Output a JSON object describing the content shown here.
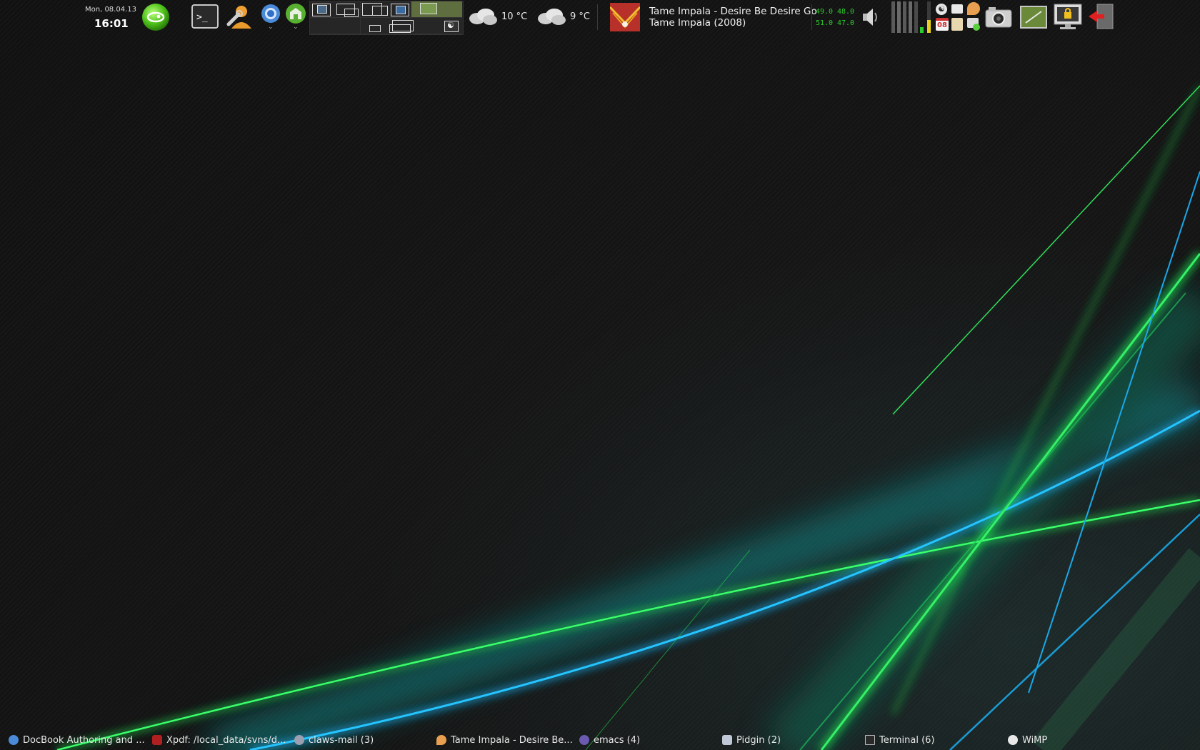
{
  "clock": {
    "date": "Mon, 08.04.13",
    "time": "16:01"
  },
  "weather": [
    {
      "icon": "cloudy-icon",
      "temp": "10 °C"
    },
    {
      "icon": "cloudy-icon",
      "temp": "9 °C"
    }
  ],
  "now_playing": {
    "title_line": "Tame Impala - Desire Be Desire Go",
    "album_line": "Tame Impala (2008)"
  },
  "sensors": {
    "a1": "49.0",
    "a2": "48.0",
    "b1": "51.0",
    "b2": "47.0"
  },
  "calendar_day": "08",
  "colors": {
    "accent_green": "#1fd04a",
    "accent_blue": "#19a8e8",
    "sensor_green": "#2ecc2e"
  },
  "taskbar": [
    {
      "label": "DocBook Authoring and ...",
      "icon": "browser-icon"
    },
    {
      "label": "Xpdf: /local_data/svns/d...",
      "icon": "pdf-icon"
    },
    {
      "label": "claws-mail (3)",
      "icon": "mail-icon"
    },
    {
      "label": "Tame Impala - Desire Be...",
      "icon": "music-player-icon"
    },
    {
      "label": "emacs (4)",
      "icon": "emacs-icon"
    },
    {
      "label": "Pidgin (2)",
      "icon": "chat-icon"
    },
    {
      "label": "Terminal (6)",
      "icon": "terminal-icon"
    },
    {
      "label": "WiMP",
      "icon": "wimp-icon"
    }
  ]
}
